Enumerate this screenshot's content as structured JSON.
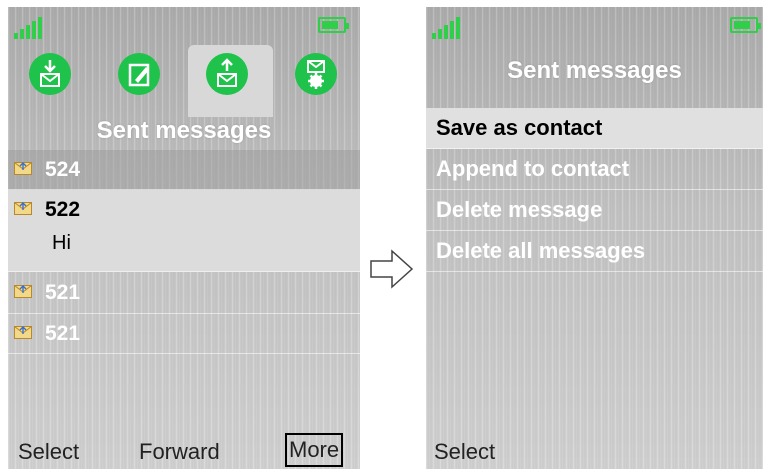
{
  "left_screen": {
    "header_title": "Sent messages",
    "tabs": [
      {
        "name": "inbox-download-icon",
        "selected": false
      },
      {
        "name": "compose-edit-icon",
        "selected": false
      },
      {
        "name": "sent-upload-icon",
        "selected": true
      },
      {
        "name": "message-settings-icon",
        "selected": false
      }
    ],
    "messages": [
      {
        "number": "524",
        "preview": "",
        "selected": false
      },
      {
        "number": "522",
        "preview": "Hi",
        "selected": true
      },
      {
        "number": "521",
        "preview": "",
        "selected": false
      },
      {
        "number": "521",
        "preview": "",
        "selected": false
      }
    ],
    "softkeys": {
      "left": "Select",
      "middle": "Forward",
      "right": "More"
    }
  },
  "right_screen": {
    "header_title": "Sent messages",
    "menu": [
      {
        "label": "Save as contact",
        "selected": true
      },
      {
        "label": "Append to contact",
        "selected": false
      },
      {
        "label": "Delete message",
        "selected": false
      },
      {
        "label": "Delete all messages",
        "selected": false
      }
    ],
    "softkeys": {
      "left": "Select"
    }
  },
  "colors": {
    "accent_green": "#1fc24a",
    "signal_green": "#2fcf4a"
  }
}
